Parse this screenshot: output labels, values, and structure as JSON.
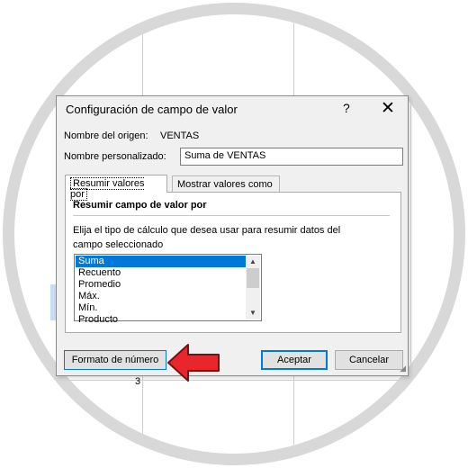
{
  "dialog": {
    "title": "Configuración de campo de valor",
    "help_label": "?",
    "close_label": "✕",
    "source_name_label": "Nombre del origen:",
    "source_name_value": "VENTAS",
    "custom_name_label": "Nombre personalizado:",
    "custom_name_value": "Suma de VENTAS",
    "tabs": [
      {
        "label": "Resumir valores por",
        "active": true
      },
      {
        "label": "Mostrar valores como",
        "active": false
      }
    ],
    "group_title": "Resumir campo de valor por",
    "description": "Elija el tipo de cálculo que desea usar para resumir datos del campo seleccionado",
    "calc_options": [
      {
        "label": "Suma",
        "selected": true
      },
      {
        "label": "Recuento",
        "selected": false
      },
      {
        "label": "Promedio",
        "selected": false
      },
      {
        "label": "Máx.",
        "selected": false
      },
      {
        "label": "Mín.",
        "selected": false
      },
      {
        "label": "Producto",
        "selected": false
      }
    ],
    "buttons": {
      "number_format": "Formato de número",
      "accept": "Aceptar",
      "cancel": "Cancelar"
    }
  },
  "sheet": {
    "visible_cell_value": "3"
  },
  "colors": {
    "accent": "#0078d7",
    "arrow": "#e8262b",
    "frame": "#d8d8d8"
  },
  "icons": {
    "pointer": "red-arrow-icon",
    "scroll_up": "chevron-up-icon",
    "scroll_down": "chevron-down-icon"
  }
}
